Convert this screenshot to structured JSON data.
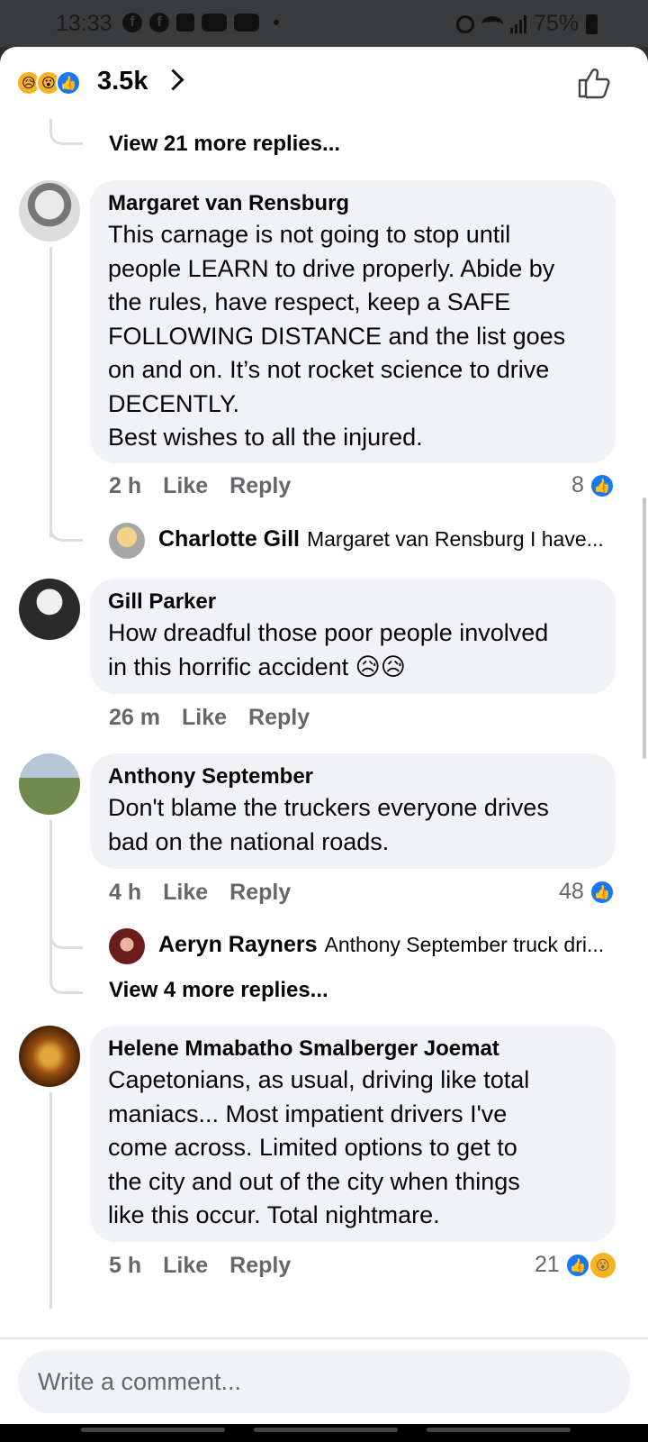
{
  "status_bar": {
    "time": "13:33",
    "battery": "75%",
    "icons": [
      "facebook-icon",
      "facebook-icon",
      "shopping-bag-icon",
      "youtube-icon",
      "youtube-icon",
      "alarm-icon",
      "wifi-icon",
      "signal-icon",
      "battery-icon"
    ]
  },
  "header": {
    "reaction_count": "3.5k",
    "reaction_icons": [
      "sad-emoji",
      "wow-emoji",
      "like-icon"
    ]
  },
  "top_more_replies": "View 21 more replies...",
  "comments": [
    {
      "name": "Margaret van Rensburg",
      "text": "This carnage is not going to stop until\npeople LEARN to drive properly. Abide by\nthe rules, have respect, keep a SAFE\nFOLLOWING DISTANCE and the list goes\non and on. It’s not rocket science to drive\nDECENTLY.\nBest wishes to all the injured.",
      "time": "2 h",
      "like": "Like",
      "reply": "Reply",
      "likes": "8",
      "reply_preview": {
        "name": "Charlotte Gill",
        "text": "Margaret van Rensburg I have..."
      }
    },
    {
      "name": "Gill Parker",
      "text": "How dreadful those poor people involved\nin this horrific accident 😥😥",
      "time": "26 m",
      "like": "Like",
      "reply": "Reply"
    },
    {
      "name": "Anthony September",
      "text": "Don't blame the truckers everyone drives\nbad on the national roads.",
      "time": "4 h",
      "like": "Like",
      "reply": "Reply",
      "likes": "48",
      "reply_preview": {
        "name": "Aeryn Rayners",
        "text": "Anthony September truck dri..."
      },
      "more_replies": "View 4 more replies..."
    },
    {
      "name": "Helene Mmabatho Smalberger Joemat",
      "text": "Capetonians, as usual, driving like total\nmaniacs... Most impatient drivers I've\ncome across. Limited options to get to\nthe city and out of the city when things\nlike this occur. Total nightmare.",
      "time": "5 h",
      "like": "Like",
      "reply": "Reply",
      "likes": "21"
    }
  ],
  "composer": {
    "placeholder": "Write a comment..."
  },
  "colors": {
    "accent": "#1877f2",
    "bubble": "#f0f2f5",
    "meta": "#65676b",
    "reaction_yellow": "#f7b125"
  }
}
